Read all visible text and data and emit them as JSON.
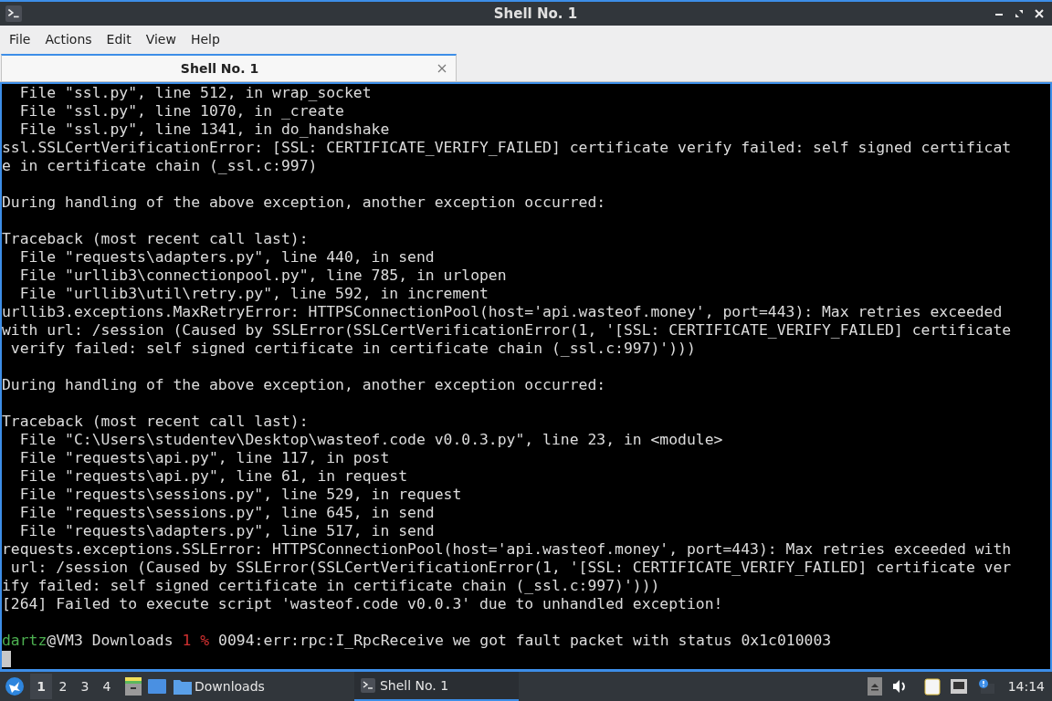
{
  "window": {
    "title": "Shell No. 1"
  },
  "menu": [
    "File",
    "Actions",
    "Edit",
    "View",
    "Help"
  ],
  "tabs": [
    {
      "label": "Shell No. 1",
      "selected": true
    }
  ],
  "terminal": {
    "lines": [
      {
        "kind": "text",
        "text": "  File \"ssl.py\", line 512, in wrap_socket"
      },
      {
        "kind": "text",
        "text": "  File \"ssl.py\", line 1070, in _create"
      },
      {
        "kind": "text",
        "text": "  File \"ssl.py\", line 1341, in do_handshake"
      },
      {
        "kind": "text",
        "text": "ssl.SSLCertVerificationError: [SSL: CERTIFICATE_VERIFY_FAILED] certificate verify failed: self signed certificat"
      },
      {
        "kind": "text",
        "text": "e in certificate chain (_ssl.c:997)"
      },
      {
        "kind": "blank"
      },
      {
        "kind": "text",
        "text": "During handling of the above exception, another exception occurred:"
      },
      {
        "kind": "blank"
      },
      {
        "kind": "text",
        "text": "Traceback (most recent call last):"
      },
      {
        "kind": "text",
        "text": "  File \"requests\\adapters.py\", line 440, in send"
      },
      {
        "kind": "text",
        "text": "  File \"urllib3\\connectionpool.py\", line 785, in urlopen"
      },
      {
        "kind": "text",
        "text": "  File \"urllib3\\util\\retry.py\", line 592, in increment"
      },
      {
        "kind": "text",
        "text": "urllib3.exceptions.MaxRetryError: HTTPSConnectionPool(host='api.wasteof.money', port=443): Max retries exceeded"
      },
      {
        "kind": "text",
        "text": "with url: /session (Caused by SSLError(SSLCertVerificationError(1, '[SSL: CERTIFICATE_VERIFY_FAILED] certificate"
      },
      {
        "kind": "text",
        "text": " verify failed: self signed certificate in certificate chain (_ssl.c:997)')))"
      },
      {
        "kind": "blank"
      },
      {
        "kind": "text",
        "text": "During handling of the above exception, another exception occurred:"
      },
      {
        "kind": "blank"
      },
      {
        "kind": "text",
        "text": "Traceback (most recent call last):"
      },
      {
        "kind": "text",
        "text": "  File \"C:\\Users\\studentev\\Desktop\\wasteof.code v0.0.3.py\", line 23, in <module>"
      },
      {
        "kind": "text",
        "text": "  File \"requests\\api.py\", line 117, in post"
      },
      {
        "kind": "text",
        "text": "  File \"requests\\api.py\", line 61, in request"
      },
      {
        "kind": "text",
        "text": "  File \"requests\\sessions.py\", line 529, in request"
      },
      {
        "kind": "text",
        "text": "  File \"requests\\sessions.py\", line 645, in send"
      },
      {
        "kind": "text",
        "text": "  File \"requests\\adapters.py\", line 517, in send"
      },
      {
        "kind": "text",
        "text": "requests.exceptions.SSLError: HTTPSConnectionPool(host='api.wasteof.money', port=443): Max retries exceeded with"
      },
      {
        "kind": "text",
        "text": " url: /session (Caused by SSLError(SSLCertVerificationError(1, '[SSL: CERTIFICATE_VERIFY_FAILED] certificate ver"
      },
      {
        "kind": "text",
        "text": "ify failed: self signed certificate in certificate chain (_ssl.c:997)')))"
      },
      {
        "kind": "text",
        "text": "[264] Failed to execute script 'wasteof.code v0.0.3' due to unhandled exception!"
      },
      {
        "kind": "blank"
      },
      {
        "kind": "prompt",
        "user": "dartz",
        "host_path": "@VM3 Downloads",
        "status": "1 %",
        "command": "0094:err:rpc:I_RpcReceive we got fault packet with status 0x1c010003"
      },
      {
        "kind": "cursor"
      }
    ]
  },
  "taskbar": {
    "workspaces": [
      {
        "label": "1",
        "selected": true
      },
      {
        "label": "2",
        "selected": false
      },
      {
        "label": "3",
        "selected": false
      },
      {
        "label": "4",
        "selected": false
      }
    ],
    "folder": {
      "label": "Downloads"
    },
    "tasks": [
      {
        "label": "Shell No. 1",
        "selected": true
      }
    ],
    "clock": "14:14"
  }
}
